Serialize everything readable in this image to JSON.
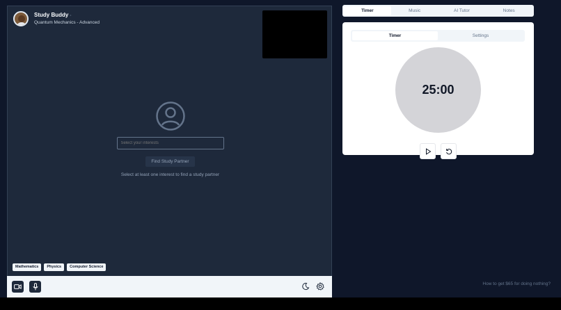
{
  "header": {
    "title": "Study Buddy",
    "title_dot": "•",
    "subtitle": "Quantum Mechanics - Advanced"
  },
  "match": {
    "interests_placeholder": "Select your interests",
    "find_button": "Find Study Partner",
    "hint": "Select at least one interest to find a study partner"
  },
  "tags": [
    "Mathematics",
    "Physics",
    "Computer Science"
  ],
  "tabs": [
    "Timer",
    "Music",
    "AI Tutor",
    "Notes"
  ],
  "timer": {
    "subtabs": [
      "Timer",
      "Settings"
    ],
    "display": "25:00"
  },
  "promo": "How to get $65 for doing nothing?",
  "colors": {
    "app_bg": "#0f172a",
    "panel_bg": "#1e293b",
    "card_bg": "#ffffff",
    "timer_circle": "#d4d4d8"
  },
  "icons": [
    "user-icon",
    "video-camera-icon",
    "microphone-icon",
    "moon-icon",
    "gear-icon",
    "play-icon",
    "reset-icon"
  ]
}
